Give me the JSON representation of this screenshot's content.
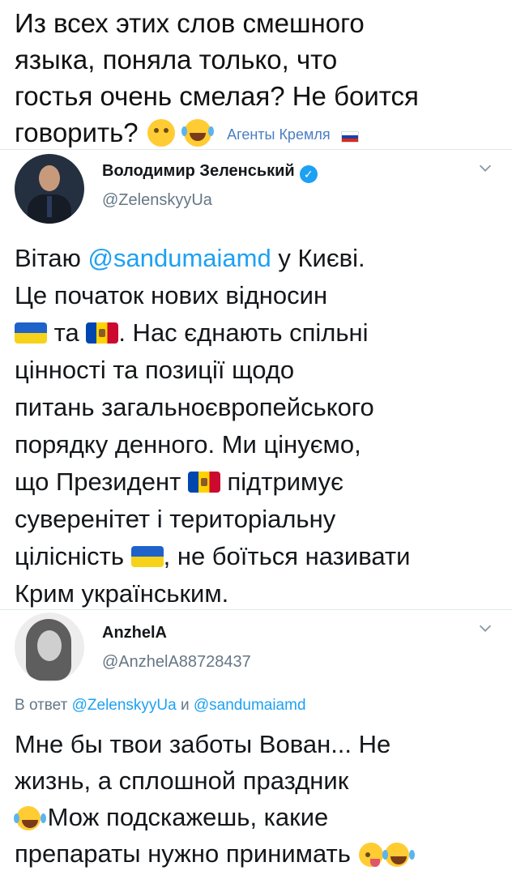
{
  "top_comment": {
    "lines": [
      "Из всех этих слов смешного",
      "языка, поняла только, что",
      "гостья очень смелая? Не боится",
      "говорить?"
    ],
    "emojis": [
      "thinking-face",
      "face-with-tears-of-joy"
    ],
    "tag": "Агенты Кремля",
    "flag": "russia-flag"
  },
  "tweet_main": {
    "display_name": "Володимир Зеленський",
    "handle": "@ZelenskyyUa",
    "verified": true,
    "body": {
      "l1_pre": "Вітаю ",
      "l1_mention": "@sandumaiamd",
      "l1_post": " у Києві.",
      "l2": "Це початок нових відносин",
      "l3_mid": " та ",
      "l3_post": ". Нас єднають спільні",
      "l4": "цінності та позиції щодо",
      "l5": "питань загальноєвропейського",
      "l6": "порядку денного. Ми цінуємо,",
      "l7_pre": "що Президент ",
      "l7_post": " підтримує",
      "l8": "суверенітет і територіальну",
      "l9_pre": "цілісність ",
      "l9_post": ", не боїться називати",
      "l10": "Крим українським."
    },
    "flags": [
      "ukraine-flag",
      "moldova-flag"
    ]
  },
  "tweet_reply": {
    "display_name": "AnzhelA",
    "handle": "@AnzhelA88728437",
    "reply_to": {
      "prefix": "В ответ ",
      "mention1": "@ZelenskyyUa",
      "joiner": " и ",
      "mention2": "@sandumaiamd"
    },
    "body": {
      "l1": "Мне бы твои заботы Вован... Не",
      "l2": "жизнь, а сплошной праздник",
      "l3": " Мож подскажешь, какие",
      "l4": "препараты нужно принимать "
    },
    "emojis": [
      "face-with-tears-of-joy",
      "winking-face-with-tongue",
      "face-with-tears-of-joy"
    ]
  },
  "colors": {
    "link": "#1da1f2",
    "secondary_text": "#657786",
    "divider": "#e1e8ed",
    "verified": "#1da1f2"
  }
}
